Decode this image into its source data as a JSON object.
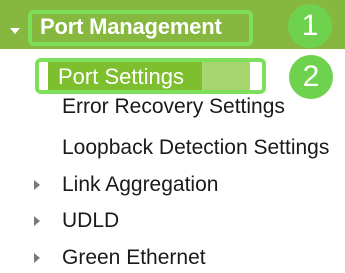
{
  "nav": {
    "section_title": "Port Management",
    "selected_item": "Port Settings",
    "sub_items": [
      {
        "label": "Error Recovery Settings"
      },
      {
        "label": "Loopback Detection Settings"
      }
    ],
    "collapsed_groups": [
      {
        "label": "Link Aggregation"
      },
      {
        "label": "UDLD"
      },
      {
        "label": "Green Ethernet"
      }
    ]
  },
  "callouts": [
    {
      "label": "1"
    },
    {
      "label": "2"
    }
  ],
  "colors": {
    "header_bg": "#86b73e",
    "selected_bg": "#7dbf2f",
    "highlight": "#7ee05a",
    "callout": "#6ed24e"
  }
}
